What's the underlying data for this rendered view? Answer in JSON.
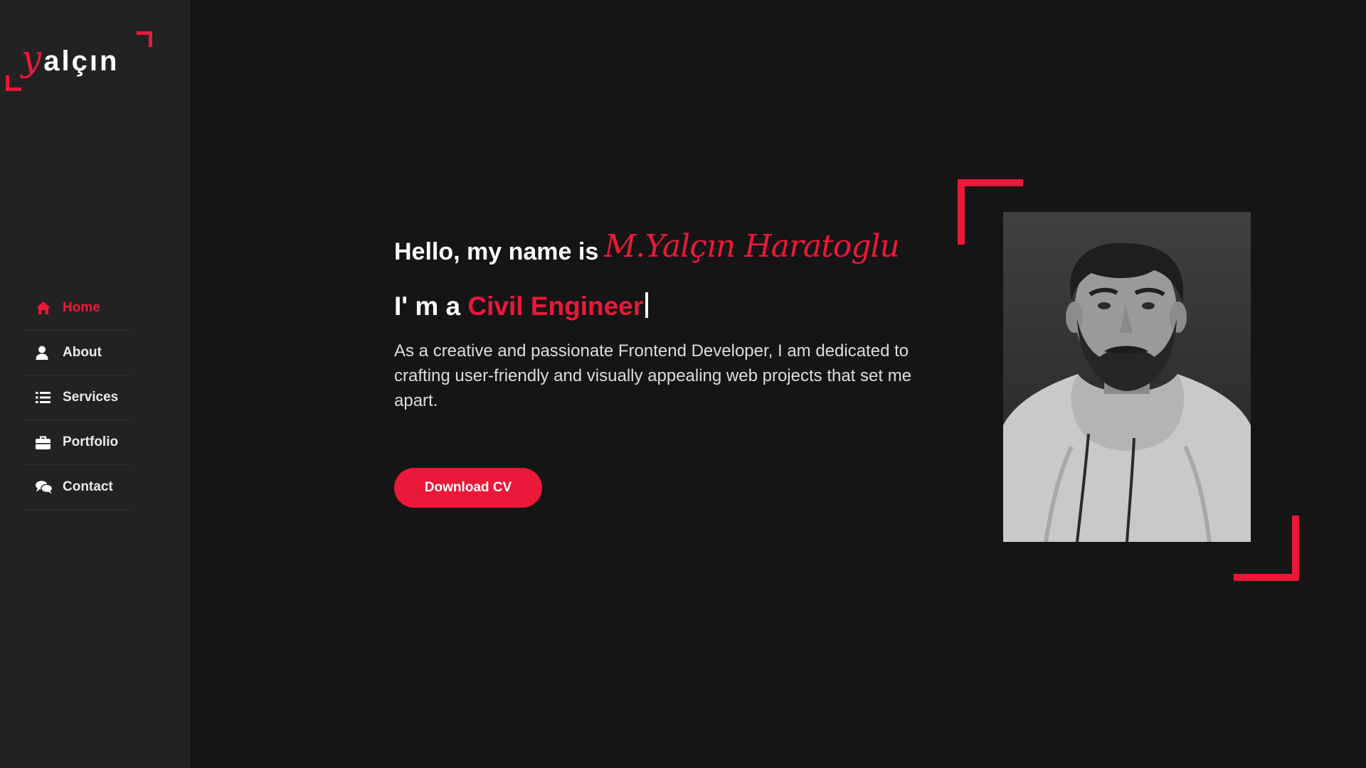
{
  "logo": {
    "initial": "y",
    "rest": "alçın"
  },
  "nav": {
    "items": [
      {
        "label": "Home",
        "icon": "home-icon",
        "active": true
      },
      {
        "label": "About",
        "icon": "user-icon",
        "active": false
      },
      {
        "label": "Services",
        "icon": "list-icon",
        "active": false
      },
      {
        "label": "Portfolio",
        "icon": "briefcase-icon",
        "active": false
      },
      {
        "label": "Contact",
        "icon": "comments-icon",
        "active": false
      }
    ]
  },
  "hero": {
    "greeting": "Hello, my name is",
    "signature": "M.Yalçın Haratoglu",
    "role_prefix": "I' m a",
    "role": "Civil Engineer",
    "description": "As a creative and passionate Frontend Developer, I am dedicated to crafting user-friendly and visually appealing web projects that set me apart.",
    "cta_label": "Download CV"
  },
  "colors": {
    "accent": "#ec1839",
    "background": "#151515",
    "sidebar": "#222222",
    "text": "#ffffff"
  }
}
